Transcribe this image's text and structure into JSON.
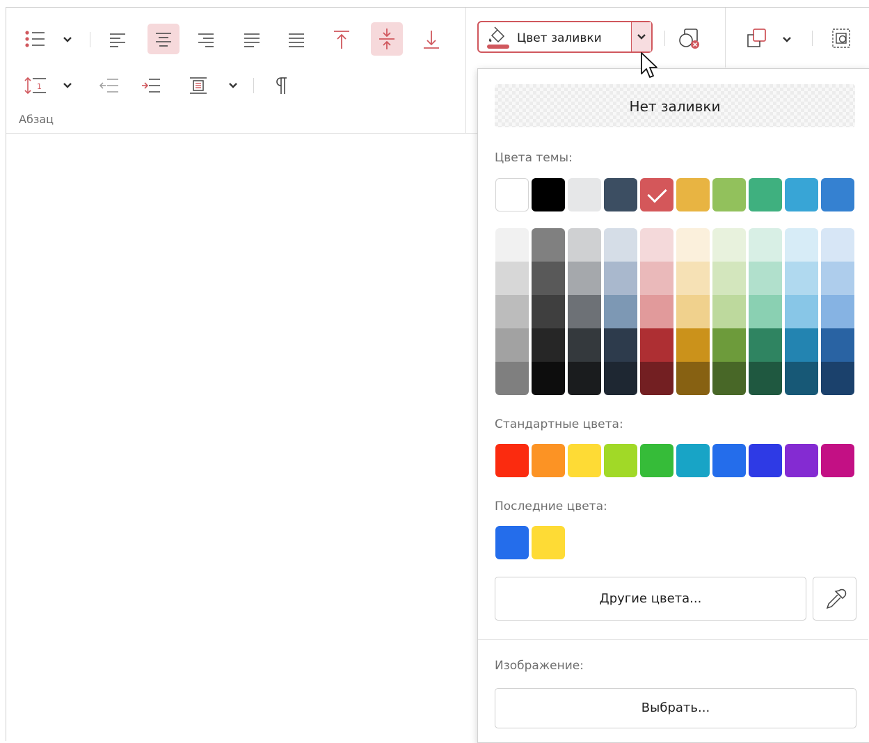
{
  "ribbon": {
    "paragraph_group_label": "Абзац",
    "fill_button_label": "Цвет заливки",
    "accent_color": "#cf4a52",
    "icons": [
      "bulleted-list-icon",
      "chevron-down-icon",
      "align-left-icon",
      "align-center-icon",
      "align-right-icon",
      "align-justify-icon",
      "distribute-icon",
      "align-top-icon",
      "align-middle-icon",
      "align-bottom-icon",
      "line-spacing-icon",
      "decrease-indent-icon",
      "increase-indent-icon",
      "paragraph-spacing-icon",
      "pilcrow-icon",
      "paint-bucket-icon",
      "shape-no-line-icon",
      "arrange-icon",
      "group-shapes-icon"
    ]
  },
  "fill_menu": {
    "no_fill_label": "Нет заливки",
    "theme_colors_label": "Цвета темы:",
    "theme_colors": [
      "#ffffff",
      "#000000",
      "#e6e7e8",
      "#3c4e62",
      "#d4575a",
      "#e8b442",
      "#92c15c",
      "#3fb07f",
      "#38a5d6",
      "#3581d1"
    ],
    "selected_theme_index": 4,
    "shade_columns": [
      [
        "#f1f1f1",
        "#d7d7d7",
        "#bcbcbc",
        "#a2a2a2",
        "#7f7f7f"
      ],
      [
        "#808080",
        "#595959",
        "#3f3f3f",
        "#262626",
        "#0d0d0d"
      ],
      [
        "#cfd0d2",
        "#a5a8ac",
        "#6d7176",
        "#34393d",
        "#1a1c1e"
      ],
      [
        "#d5dde7",
        "#a9b8cd",
        "#7d98b4",
        "#2d3b4c",
        "#1e2732"
      ],
      [
        "#f4d9da",
        "#eab9ba",
        "#e19a9b",
        "#ae2f33",
        "#731f22"
      ],
      [
        "#fbf0dc",
        "#f6e1b5",
        "#f0d18d",
        "#cb921b",
        "#876112"
      ],
      [
        "#e8f2dd",
        "#d3e6bd",
        "#bdd99d",
        "#6d9b3b",
        "#486727"
      ],
      [
        "#d8efe5",
        "#b1e0cc",
        "#8ad0b2",
        "#2f8461",
        "#1f5840"
      ],
      [
        "#d7ecf7",
        "#b0d9ef",
        "#88c6e7",
        "#2384b1",
        "#175876"
      ],
      [
        "#d7e6f6",
        "#aecdec",
        "#86b3e3",
        "#2963a3",
        "#1b416c"
      ]
    ],
    "standard_colors_label": "Стандартные цвета:",
    "standard_colors": [
      "#fb2b0f",
      "#fc9324",
      "#fedb35",
      "#a1d927",
      "#36bc39",
      "#18a4c6",
      "#246deb",
      "#2e3ae5",
      "#842bd2",
      "#c31084"
    ],
    "recent_colors_label": "Последние цвета:",
    "recent_colors": [
      "#246deb",
      "#fedb35"
    ],
    "more_colors_label": "Другие цвета...",
    "image_label": "Изображение:",
    "choose_label": "Выбрать..."
  }
}
